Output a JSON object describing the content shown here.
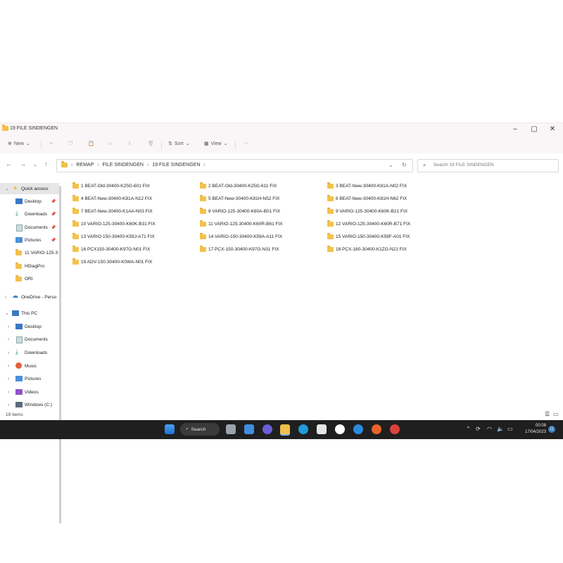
{
  "window": {
    "title": "19 FILE SINDENGEN",
    "minimize": "–",
    "maximize": "▢",
    "close": "✕"
  },
  "commandbar": {
    "new_label": "New",
    "sort_label": "Sort",
    "view_label": "View",
    "more_label": "···"
  },
  "address": {
    "crumbs": [
      "REMAP",
      "FILE SINDENGEN",
      "19 FILE SINDENGEN"
    ],
    "search_placeholder": "Search 19 FILE SINDENGEN"
  },
  "sidebar": {
    "quick_access": "Quick access",
    "items": [
      {
        "label": "Desktop",
        "icon": "desktop-icon",
        "pinned": true
      },
      {
        "label": "Downloads",
        "icon": "download-icon",
        "pinned": true
      },
      {
        "label": "Documents",
        "icon": "documents-icon",
        "pinned": true
      },
      {
        "label": "Pictures",
        "icon": "pictures-icon",
        "pinned": true
      },
      {
        "label": "11 VARIO-125-3",
        "icon": "folder-icon",
        "pinned": false
      },
      {
        "label": "HDiagPro",
        "icon": "folder-icon",
        "pinned": false
      },
      {
        "label": "ORI",
        "icon": "folder-icon",
        "pinned": false
      }
    ],
    "onedrive": "OneDrive - Perso",
    "this_pc": "This PC",
    "pc_items": [
      {
        "label": "Desktop",
        "icon": "desktop-icon"
      },
      {
        "label": "Documents",
        "icon": "documents-icon"
      },
      {
        "label": "Downloads",
        "icon": "download-icon"
      },
      {
        "label": "Music",
        "icon": "music-icon"
      },
      {
        "label": "Pictures",
        "icon": "pictures-icon"
      },
      {
        "label": "Videos",
        "icon": "videos-icon"
      },
      {
        "label": "Windows (C:)",
        "icon": "drive-icon"
      }
    ]
  },
  "files": [
    "1 BEAT-Old-30400-K25G-601 FIX",
    "2 BEAT-Old-30400-K25G-611 FIX",
    "3 BEAT-New-30400-K81A-N02 FIX",
    "4 BEAT-New-30400-K81A-N12 FIX",
    "5 BEAT-New-30400-K81H-N52 FIX",
    "6 BEAT-New-30400-K81H-N62 FIX",
    "7 BEAT-New-30400-K1AA-N03 FIX",
    "8 VARIO-125-30400-K60A-B01 FIX",
    "9 VARIO-125-30400-K60K-B21 FIX",
    "10 VARIO-125-30400-K60K-B31 FIX",
    "11 VARIO-125-30400-K60R-B61 FIX",
    "12 VARIO-125-30400-K60R-B71 FIX",
    "13 VARIO-150-30400-K59J-A71 FIX",
    "14 VARIO-150-30400-K59A-A11 FIX",
    "15 VARIO-150-30400-K59F-A01 FIX",
    "16 PCX150-30400-K97G-N01 FIX",
    "17 PCX-150-30400-K97G-N31 FIX",
    "18 PCX-160-30400-K1ZG-N21 FIX",
    "19 ADV-150-30400-K0WA-N01 FIX"
  ],
  "status": {
    "items_count": "19 items"
  },
  "taskbar": {
    "search_label": "Search",
    "time": "00:08",
    "date": "17/04/2023",
    "notification_count": "11"
  },
  "colors": {
    "folder": "#f3c24b",
    "taskbar": "#1f1f1f",
    "accent": "#3b82c4"
  }
}
